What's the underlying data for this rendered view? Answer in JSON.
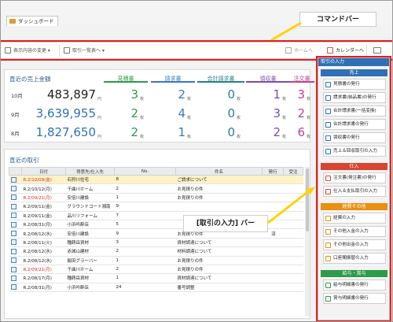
{
  "tab": {
    "title": "ダッシュボード"
  },
  "toolbar": {
    "display_change": "表示内容の変更",
    "trans_list": "取引一覧表へ",
    "home": "ホームへ",
    "calendar": "カレンダーへ"
  },
  "callouts": {
    "command_bar": "コマンドバー",
    "input_bar": "[取引の入力] バー"
  },
  "sales": {
    "title": "直近の売上金額",
    "yen_unit": "円",
    "count_unit": "枚",
    "rows": [
      {
        "month": "10月",
        "amount": "483,897"
      },
      {
        "month": "9月",
        "amount": "3,639,955"
      },
      {
        "month": "8月",
        "amount": "1,827,650"
      }
    ],
    "cards": [
      {
        "label": "見積書",
        "color": "#2e9b4a",
        "values": [
          "3",
          "2",
          "2"
        ]
      },
      {
        "label": "請求書",
        "color": "#3a78c3",
        "values": [
          "2",
          "4",
          "1"
        ]
      },
      {
        "label": "合計請求書",
        "color": "#2a7f86",
        "values": [
          "0",
          "0",
          "0"
        ]
      },
      {
        "label": "領収書",
        "color": "#7b4fa8",
        "values": [
          "1",
          "3",
          "2"
        ]
      },
      {
        "label": "注文書",
        "color": "#c2418e",
        "values": [
          "3",
          "2",
          "6"
        ]
      }
    ]
  },
  "recent": {
    "title": "直近の取引",
    "headers": [
      "日付",
      "得意先/仕入先",
      "No.",
      "件名",
      "発行",
      "受注"
    ],
    "rows": [
      {
        "date": "R.2/10/09(金)",
        "partner": "石狩川住宅",
        "no": "8",
        "subject": "ご請求について",
        "issued": "",
        "order": "",
        "red": true,
        "selected": true
      },
      {
        "date": "R.2/10/12(月)",
        "partner": "千曲川ホーム",
        "no": "2",
        "subject": "お見積りの件",
        "issued": "",
        "order": "",
        "red": false,
        "selected": false
      },
      {
        "date": "R.2/09/21(月)",
        "partner": "安倍川建設",
        "no": "1",
        "subject": "お見積りの件",
        "issued": "",
        "order": "",
        "red": true,
        "selected": false
      },
      {
        "date": "R.2/09/11(金)",
        "partner": "グラウンドコート湘南",
        "no": "9",
        "subject": "",
        "issued": "",
        "order": "",
        "red": false,
        "selected": false
      },
      {
        "date": "R.2/09/11(金)",
        "partner": "品川リフォーム",
        "no": "7",
        "subject": "",
        "issued": "",
        "order": "",
        "red": false,
        "selected": false
      },
      {
        "date": "R.2/08/31(月)",
        "partner": "小浜吟酔店",
        "no": "5",
        "subject": "",
        "issued": "",
        "order": "",
        "red": false,
        "selected": false
      },
      {
        "date": "R.2/08/12(水)",
        "partner": "安倍川建設",
        "no": "9",
        "subject": "お見積りの件",
        "issued": "済",
        "order": "",
        "red": false,
        "selected": false
      },
      {
        "date": "R.2/08/11(火)",
        "partner": "種蒔岳資材",
        "no": "3",
        "subject": "資材調達について",
        "issued": "",
        "order": "",
        "red": false,
        "selected": false
      },
      {
        "date": "R.2/08/12(水)",
        "partner": "赤城山建材",
        "no": "2",
        "subject": "材料調達について",
        "issued": "",
        "order": "",
        "red": false,
        "selected": false
      },
      {
        "date": "R.2/08/12(水)",
        "partner": "飯田グラーバー",
        "no": "1",
        "subject": "お見積りの件",
        "issued": "",
        "order": "",
        "red": false,
        "selected": false
      },
      {
        "date": "R.2/09/21(月)",
        "partner": "千曲川ホーム",
        "no": "2",
        "subject": "お見積りの件",
        "issued": "",
        "order": "",
        "red": true,
        "selected": false
      },
      {
        "date": "R.2/08/17(月)",
        "partner": "種蒔岳資材",
        "no": "1",
        "subject": "資材調達について",
        "issued": "",
        "order": "",
        "red": false,
        "selected": false
      },
      {
        "date": "R.2/08/31(月)",
        "partner": "小浜吟酔店",
        "no": "24",
        "subject": "番号調整",
        "issued": "",
        "order": "",
        "red": false,
        "selected": false
      }
    ]
  },
  "sidebar": {
    "title": "取引の入力",
    "sections": [
      {
        "label": "売上",
        "color": "#2f6fb5",
        "items": [
          "見積書の発行",
          "請求書(納品書)の発行",
          "合計請求書(一括変換)",
          "合計請求書の発行",
          "領収書の発行",
          "売上＆回収取引の入力"
        ]
      },
      {
        "label": "仕入",
        "color": "#d9452f",
        "items": [
          "注文書(発注書)の発行",
          "仕入＆支払取引の入力"
        ]
      },
      {
        "label": "経費その他",
        "color": "#e8900f",
        "items": [
          "経費の入力",
          "その他入金の入力",
          "その他出金の入力",
          "口座間振替の入力"
        ]
      },
      {
        "label": "給与・賞与",
        "color": "#2e9b4a",
        "items": [
          "給与明細書の発行",
          "賞与明細書の発行"
        ]
      }
    ]
  }
}
